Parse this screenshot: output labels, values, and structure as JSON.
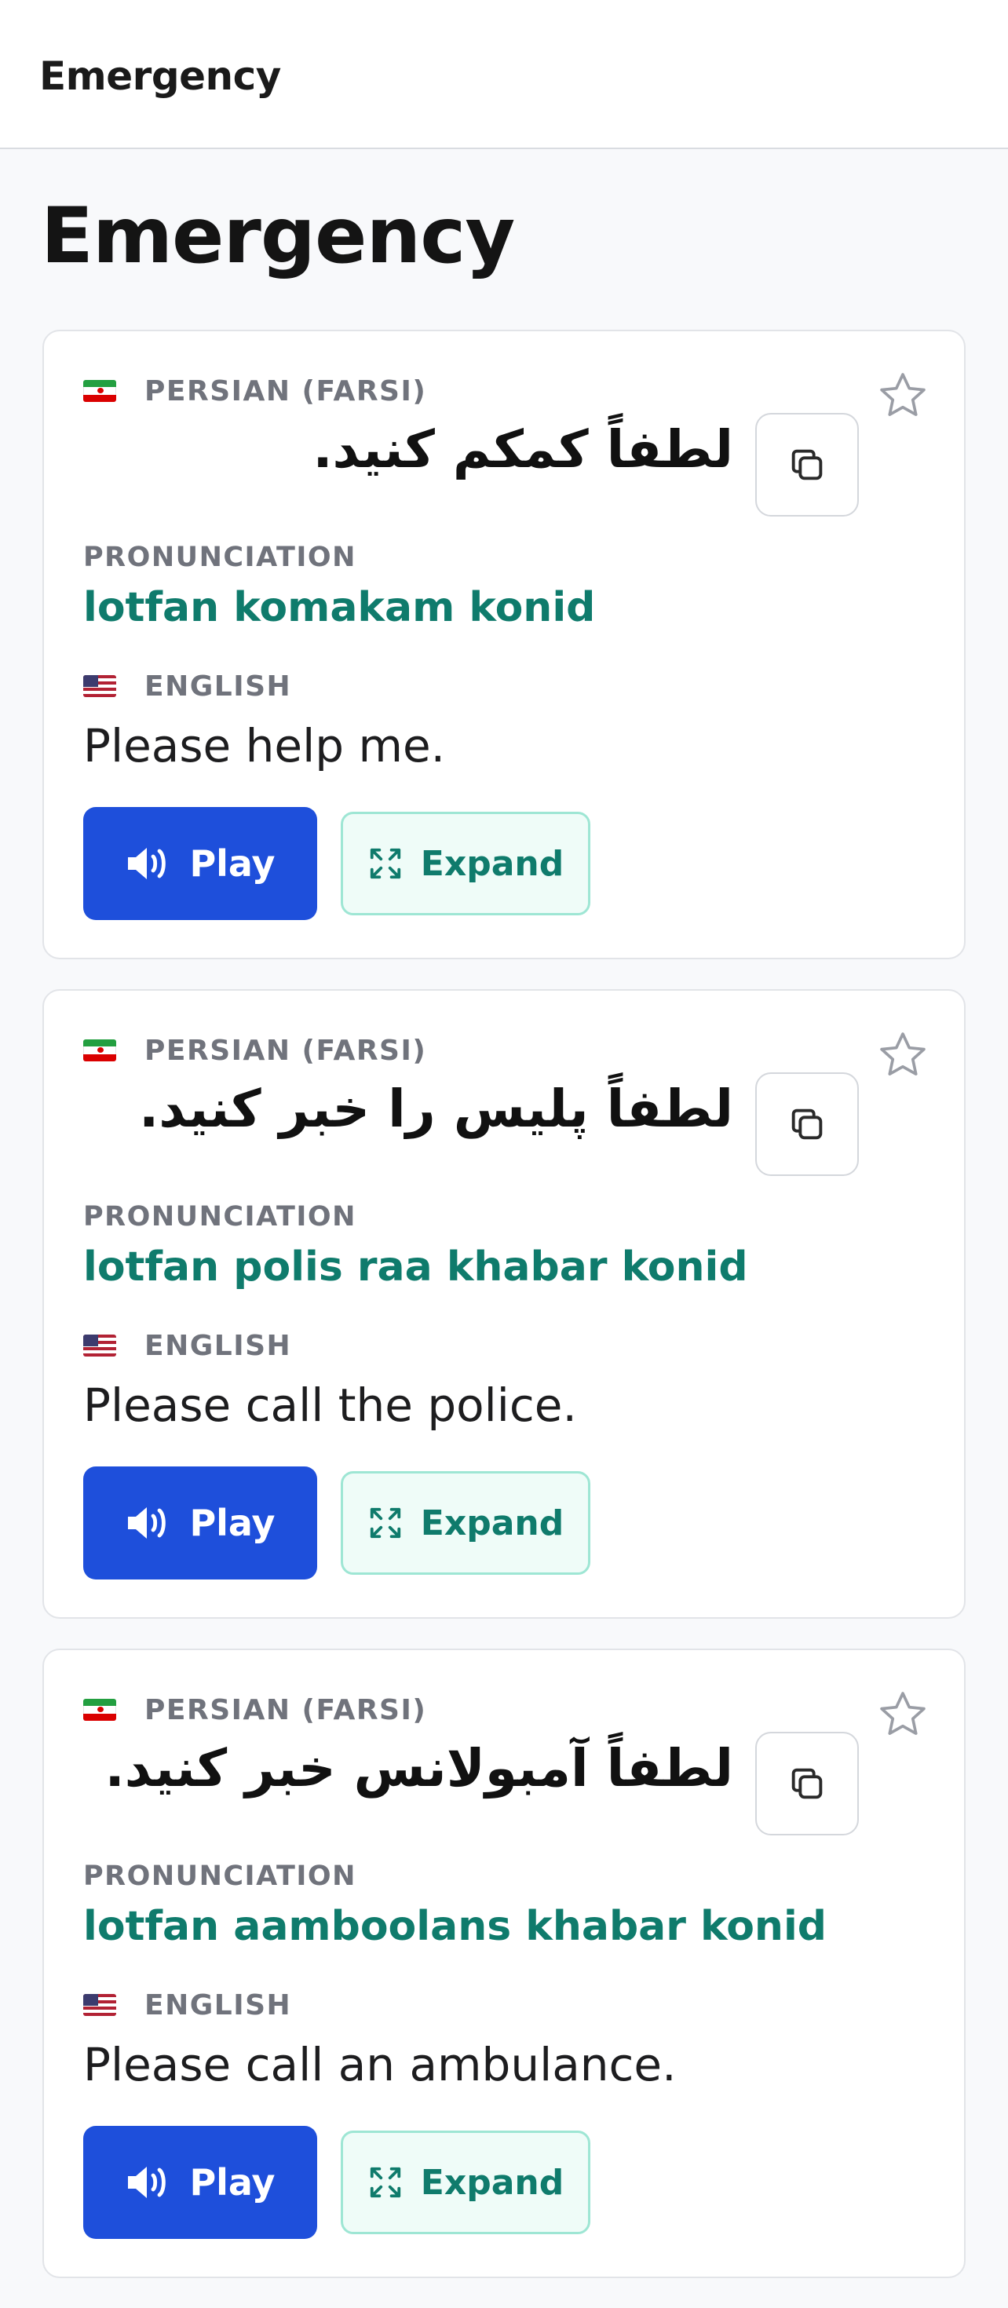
{
  "header": {
    "title": "Emergency"
  },
  "page": {
    "title": "Emergency"
  },
  "labels": {
    "pronunciation": "PRONUNCIATION",
    "play": "Play",
    "expand": "Expand"
  },
  "cards": [
    {
      "source_lang": "PERSIAN (FARSI)",
      "source_text": "لطفاً کمکم کنید.",
      "pronunciation": "lotfan komakam konid",
      "target_lang": "ENGLISH",
      "target_text": "Please help me."
    },
    {
      "source_lang": "PERSIAN (FARSI)",
      "source_text": "لطفاً پلیس را خبر کنید.",
      "pronunciation": "lotfan polis raa khabar konid",
      "target_lang": "ENGLISH",
      "target_text": "Please call the police."
    },
    {
      "source_lang": "PERSIAN (FARSI)",
      "source_text": "لطفاً آمبولانس خبر کنید.",
      "pronunciation": "lotfan aamboolans khabar konid",
      "target_lang": "ENGLISH",
      "target_text": "Please call an ambulance."
    }
  ],
  "colors": {
    "play_button": "#1e4fdb",
    "pronunciation_text": "#0f7b6c",
    "expand_border": "#9ee6d4"
  },
  "icons": {
    "play": "speaker-icon",
    "expand": "expand-icon",
    "copy": "copy-icon",
    "favorite": "star-icon",
    "source_flag": "iran-flag-icon",
    "target_flag": "us-flag-icon"
  }
}
